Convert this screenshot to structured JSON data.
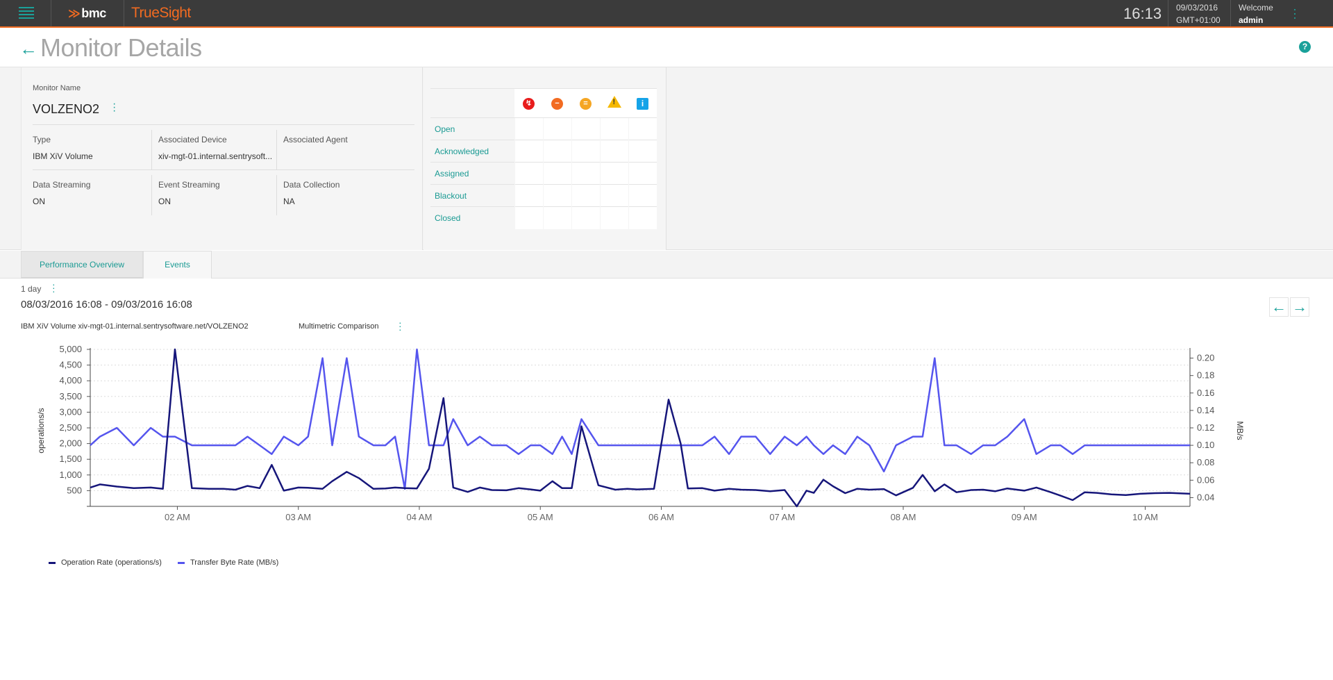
{
  "topbar": {
    "brand": "bmc",
    "product": "TrueSight",
    "time": "16:13",
    "date": "09/03/2016",
    "timezone": "GMT+01:00",
    "welcome": "Welcome",
    "user": "admin"
  },
  "page": {
    "title": "Monitor Details"
  },
  "monitor": {
    "name_label": "Monitor Name",
    "name": "VOLZENO2",
    "type_label": "Type",
    "type": "IBM XiV Volume",
    "device_label": "Associated Device",
    "device": "xiv-mgt-01.internal.sentrysoft...",
    "agent_label": "Associated Agent",
    "agent": "",
    "data_streaming_label": "Data Streaming",
    "data_streaming": "ON",
    "event_streaming_label": "Event Streaming",
    "event_streaming": "ON",
    "data_collection_label": "Data Collection",
    "data_collection": "NA"
  },
  "severity": {
    "icons": [
      "critical-icon",
      "major-icon",
      "minor-icon",
      "warning-icon",
      "info-icon"
    ],
    "colors": {
      "critical": "#e81c1c",
      "major": "#f26b21",
      "minor": "#f5a623",
      "warning": "#f5b800",
      "info": "#15a3e8"
    },
    "rows": [
      "Open",
      "Acknowledged",
      "Assigned",
      "Blackout",
      "Closed"
    ]
  },
  "tabs": [
    "Performance Overview",
    "Events"
  ],
  "period": {
    "label": "1 day",
    "range": "08/03/2016 16:08 - 09/03/2016 16:08"
  },
  "chart_header": {
    "subject": "IBM XiV Volume xiv-mgt-01.internal.sentrysoftware.net/VOLZENO2",
    "comparison": "Multimetric Comparison"
  },
  "chart_data": {
    "type": "line",
    "x_unit": "time of day (hours)",
    "x_ticks": [
      "02 AM",
      "03 AM",
      "04 AM",
      "05 AM",
      "06 AM",
      "07 AM",
      "08 AM",
      "09 AM",
      "10 AM"
    ],
    "x_range": [
      1.28,
      10.37
    ],
    "ylabel": "operations/s",
    "ylim": [
      0,
      5000
    ],
    "y_ticks": [
      "5,000",
      "4,500",
      "4,000",
      "3,500",
      "3,000",
      "2,500",
      "2,000",
      "1,500",
      "1,000",
      "500"
    ],
    "y2label": "MB/s",
    "y2lim": [
      0.03,
      0.21
    ],
    "y2_ticks": [
      "0.20",
      "0.18",
      "0.16",
      "0.14",
      "0.12",
      "0.10",
      "0.08",
      "0.06",
      "0.04"
    ],
    "grid": true,
    "legend_position": "bottom-left",
    "series": [
      {
        "name": "Operation Rate (operations/s)",
        "axis": "left",
        "color": "#16167a",
        "x": [
          1.28,
          1.36,
          1.5,
          1.64,
          1.78,
          1.88,
          1.98,
          2.12,
          2.26,
          2.38,
          2.48,
          2.58,
          2.68,
          2.78,
          2.88,
          3.0,
          3.08,
          3.2,
          3.28,
          3.4,
          3.5,
          3.62,
          3.72,
          3.8,
          3.88,
          3.98,
          4.08,
          4.2,
          4.28,
          4.4,
          4.5,
          4.6,
          4.72,
          4.82,
          4.92,
          5.0,
          5.1,
          5.18,
          5.26,
          5.34,
          5.48,
          5.62,
          5.72,
          5.8,
          5.94,
          6.06,
          6.16,
          6.22,
          6.34,
          6.44,
          6.56,
          6.66,
          6.78,
          6.9,
          7.02,
          7.12,
          7.2,
          7.26,
          7.34,
          7.42,
          7.52,
          7.62,
          7.72,
          7.84,
          7.94,
          8.08,
          8.16,
          8.26,
          8.34,
          8.44,
          8.56,
          8.66,
          8.76,
          8.86,
          9.0,
          9.1,
          9.22,
          9.3,
          9.4,
          9.5,
          9.6,
          9.72,
          9.84,
          9.96,
          10.08,
          10.2,
          10.37
        ],
        "values": [
          600,
          700,
          630,
          580,
          600,
          560,
          5000,
          580,
          560,
          560,
          530,
          650,
          580,
          1320,
          500,
          600,
          590,
          560,
          800,
          1100,
          900,
          560,
          570,
          600,
          580,
          570,
          1200,
          3450,
          600,
          460,
          600,
          520,
          510,
          580,
          540,
          500,
          800,
          580,
          580,
          2550,
          670,
          530,
          560,
          540,
          560,
          3400,
          2000,
          570,
          580,
          500,
          560,
          530,
          520,
          480,
          520,
          0,
          500,
          430,
          850,
          640,
          420,
          560,
          530,
          550,
          350,
          590,
          1000,
          480,
          700,
          450,
          520,
          530,
          480,
          570,
          500,
          600,
          450,
          340,
          200,
          450,
          430,
          380,
          360,
          400,
          420,
          430,
          400
        ]
      },
      {
        "name": "Transfer Byte Rate (MB/s)",
        "axis": "right",
        "color": "#5555ee",
        "x": [
          1.28,
          1.36,
          1.5,
          1.64,
          1.78,
          1.88,
          1.98,
          2.12,
          2.26,
          2.38,
          2.48,
          2.58,
          2.68,
          2.78,
          2.88,
          3.0,
          3.08,
          3.2,
          3.28,
          3.4,
          3.5,
          3.62,
          3.72,
          3.8,
          3.88,
          3.98,
          4.08,
          4.2,
          4.28,
          4.4,
          4.5,
          4.6,
          4.72,
          4.82,
          4.92,
          5.0,
          5.1,
          5.18,
          5.26,
          5.34,
          5.48,
          5.62,
          5.72,
          5.8,
          5.94,
          6.06,
          6.16,
          6.22,
          6.34,
          6.44,
          6.56,
          6.66,
          6.78,
          6.9,
          7.02,
          7.12,
          7.2,
          7.26,
          7.34,
          7.42,
          7.52,
          7.62,
          7.72,
          7.84,
          7.94,
          8.08,
          8.16,
          8.26,
          8.34,
          8.44,
          8.56,
          8.66,
          8.76,
          8.86,
          9.0,
          9.1,
          9.22,
          9.3,
          9.4,
          9.5,
          9.6,
          9.72,
          9.84,
          9.96,
          10.08,
          10.2,
          10.37
        ],
        "values": [
          0.1,
          0.11,
          0.12,
          0.1,
          0.12,
          0.11,
          0.11,
          0.1,
          0.1,
          0.1,
          0.1,
          0.11,
          0.1,
          0.09,
          0.11,
          0.1,
          0.11,
          0.2,
          0.1,
          0.2,
          0.11,
          0.1,
          0.1,
          0.11,
          0.05,
          0.21,
          0.1,
          0.1,
          0.13,
          0.1,
          0.11,
          0.1,
          0.1,
          0.09,
          0.1,
          0.1,
          0.09,
          0.11,
          0.09,
          0.13,
          0.1,
          0.1,
          0.1,
          0.1,
          0.1,
          0.1,
          0.1,
          0.1,
          0.1,
          0.11,
          0.09,
          0.11,
          0.11,
          0.09,
          0.11,
          0.1,
          0.11,
          0.1,
          0.09,
          0.1,
          0.09,
          0.11,
          0.1,
          0.07,
          0.1,
          0.11,
          0.11,
          0.2,
          0.1,
          0.1,
          0.09,
          0.1,
          0.1,
          0.11,
          0.13,
          0.09,
          0.1,
          0.1,
          0.09,
          0.1,
          0.1,
          0.1,
          0.1,
          0.1,
          0.1,
          0.1,
          0.1
        ]
      }
    ]
  }
}
